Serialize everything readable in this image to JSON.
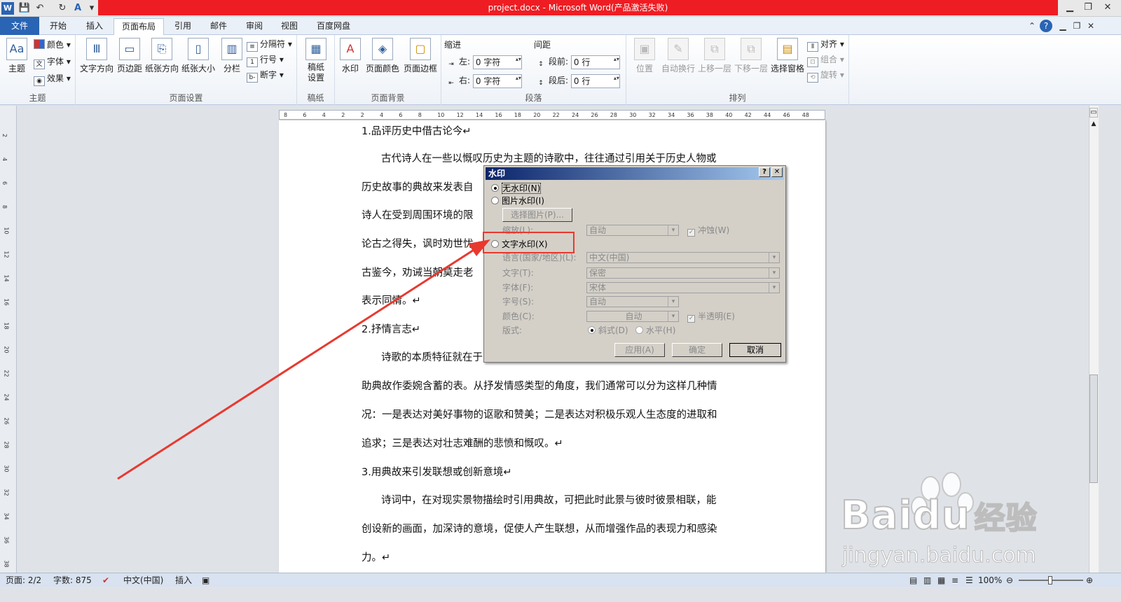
{
  "window": {
    "title": "project.docx  -  Microsoft Word(产品激活失败)"
  },
  "tabs": [
    "文件",
    "开始",
    "插入",
    "页面布局",
    "引用",
    "邮件",
    "审阅",
    "视图",
    "百度网盘"
  ],
  "active_tab": "页面布局",
  "ribbon": {
    "theme": {
      "label": "主题",
      "theme_btn": "主题",
      "colors": "颜色",
      "fonts": "字体",
      "effects": "效果"
    },
    "page_setup": {
      "label": "页面设置",
      "text_direction": "文字方向",
      "margins": "页边距",
      "orientation": "纸张方向",
      "size": "纸张大小",
      "columns": "分栏",
      "breaks": "分隔符",
      "line_numbers": "行号",
      "hyphenation": "断字"
    },
    "manuscript": {
      "label": "稿纸",
      "btn": "稿纸\n设置",
      "btn1": "稿纸",
      "btn2": "设置"
    },
    "page_background": {
      "label": "页面背景",
      "watermark": "水印",
      "page_color": "页面颜色",
      "page_borders": "页面边框"
    },
    "paragraph": {
      "label": "段落",
      "indent": "缩进",
      "spacing": "间距",
      "left_label": "左:",
      "right_label": "右:",
      "before_label": "段前:",
      "after_label": "段后:",
      "left_value": "0 字符",
      "right_value": "0 字符",
      "before_value": "0 行",
      "after_value": "0 行"
    },
    "arrange": {
      "label": "排列",
      "position": "位置",
      "wrap_text": "自动换行",
      "bring_forward": "上移一层",
      "send_backward": "下移一层",
      "selection_pane": "选择窗格",
      "align": "对齐",
      "group": "组合",
      "rotate": "旋转"
    }
  },
  "ruler_numbers": [
    "8",
    "6",
    "4",
    "2",
    "2",
    "4",
    "6",
    "8",
    "10",
    "12",
    "14",
    "16",
    "18",
    "20",
    "22",
    "24",
    "26",
    "28",
    "30",
    "32",
    "34",
    "36",
    "38",
    "40",
    "42",
    "44",
    "46",
    "48"
  ],
  "vruler_numbers": [
    "2",
    "4",
    "6",
    "8",
    "10",
    "12",
    "14",
    "16",
    "18",
    "20",
    "22",
    "24",
    "26",
    "28",
    "30",
    "32",
    "34",
    "36",
    "38"
  ],
  "document": {
    "lines": [
      "1.品评历史中借古论今↵",
      "古代诗人在一些以慨叹历史为主题的诗歌中，往往通过引用关于历史人物或",
      "历史故事的典故来发表自",
      "诗人在受到周围环境的限",
      "论古之得失，讽时劝世忧",
      "古鉴今，劝诫当朝莫走老",
      "表示同情。↵",
      "2.抒情言志↵",
      "诗歌的本质特征就在于",
      "助典故作委婉含蓄的表。从抒发情感类型的角度，我们通常可以分为这样几种情",
      "况：一是表达对美好事物的讴歌和赞美；二是表达对积极乐观人生态度的进取和",
      "追求；三是表达对壮志难酬的悲愤和慨叹。↵",
      "3.用典故来引发联想或创新意境↵",
      "诗词中，在对现实景物描绘时引用典故，可把此时此景与彼时彼景相联，能",
      "创设新的画面，加深诗的意境，促使人产生联想，从而增强作品的表现力和感染",
      "力。↵"
    ]
  },
  "dialog": {
    "title": "水印",
    "help": "?",
    "close": "✕",
    "no_watermark": "无水印(N)",
    "picture_watermark": "图片水印(I)",
    "select_picture": "选择图片(P)...",
    "scale_label": "缩放(L):",
    "scale_value": "自动",
    "washout": "冲蚀(W)",
    "text_watermark": "文字水印(X)",
    "language_label": "语言(国家/地区)(L):",
    "language_value": "中文(中国)",
    "text_label": "文字(T):",
    "text_value": "保密",
    "font_label": "字体(F):",
    "font_value": "宋体",
    "size_label": "字号(S):",
    "size_value": "自动",
    "color_label": "颜色(C):",
    "color_value": "自动",
    "semitransparent": "半透明(E)",
    "layout_label": "版式:",
    "diagonal": "斜式(D)",
    "horizontal": "水平(H)",
    "apply": "应用(A)",
    "ok": "确定",
    "cancel": "取消"
  },
  "status": {
    "page": "页面: 2/2",
    "words": "字数: 875",
    "language": "中文(中国)",
    "mode": "插入",
    "zoom": "100%"
  },
  "watermark_site": {
    "brand": "Bai",
    "brand2": "du",
    "brand3": "经验",
    "url": "jingyan.baidu.com"
  },
  "colors": {
    "title_red": "#ee1d23",
    "arrow_red": "#e8392f",
    "file_tab": "#2a64b4"
  }
}
